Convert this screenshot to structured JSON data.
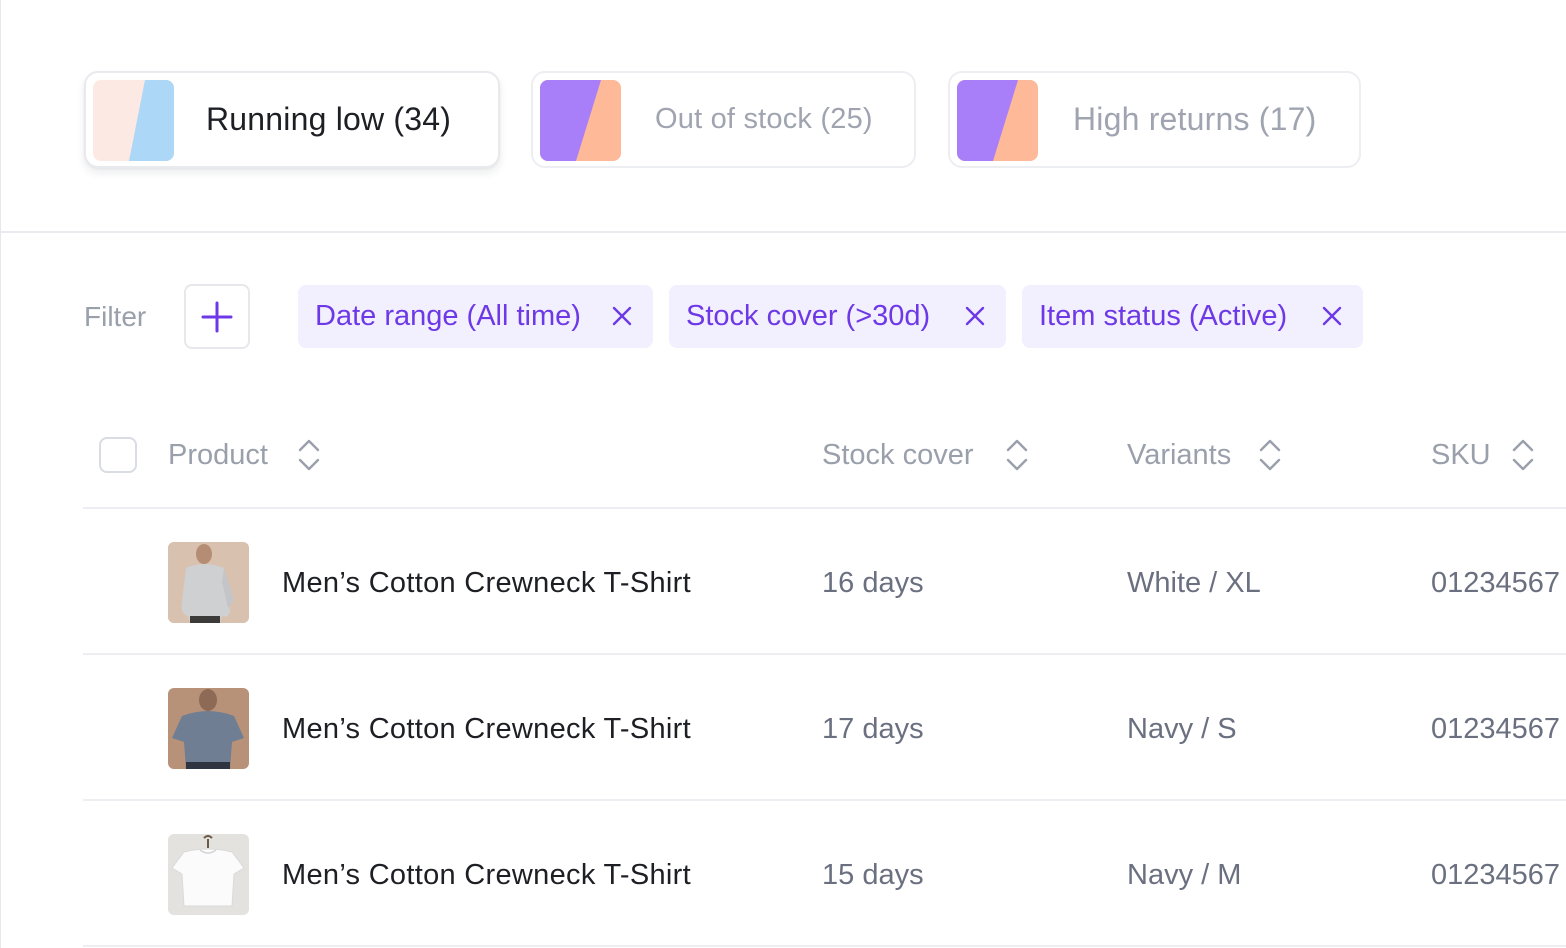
{
  "segments": [
    {
      "label": "Running low (34)",
      "active": true,
      "swatch": [
        "#fde9e4",
        "#acd7f6"
      ]
    },
    {
      "label": "Out of stock (25)",
      "active": false,
      "swatch": [
        "#a87ff8",
        "#fdb998"
      ]
    },
    {
      "label": "High returns (17)",
      "active": false,
      "swatch": [
        "#a87ff8",
        "#fdb998"
      ]
    }
  ],
  "filter": {
    "label": "Filter",
    "chips": [
      {
        "label": "Date range (All time)"
      },
      {
        "label": "Stock cover (>30d)"
      },
      {
        "label": "Item status (Active)"
      }
    ]
  },
  "table": {
    "columns": [
      {
        "label": "Product"
      },
      {
        "label": "Stock cover"
      },
      {
        "label": "Variants"
      },
      {
        "label": "SKU"
      }
    ],
    "rows": [
      {
        "product": "Men’s Cotton Crewneck T-Shirt",
        "stock_cover": "16 days",
        "variant": "White / XL",
        "sku": "01234567",
        "thumbnail": "gray-longsleeve-photo"
      },
      {
        "product": "Men’s Cotton Crewneck T-Shirt",
        "stock_cover": "17 days",
        "variant": "Navy / S",
        "sku": "01234567",
        "thumbnail": "blue-tshirt-photo"
      },
      {
        "product": "Men’s Cotton Crewneck T-Shirt",
        "stock_cover": "15 days",
        "variant": "Navy / M",
        "sku": "01234567",
        "thumbnail": "white-tshirt-hanger-photo"
      }
    ]
  },
  "colors": {
    "accent": "#6d39e6",
    "chip_bg": "#f2efff",
    "muted_text": "#9aa0ab",
    "body_text": "#1d1f24"
  }
}
